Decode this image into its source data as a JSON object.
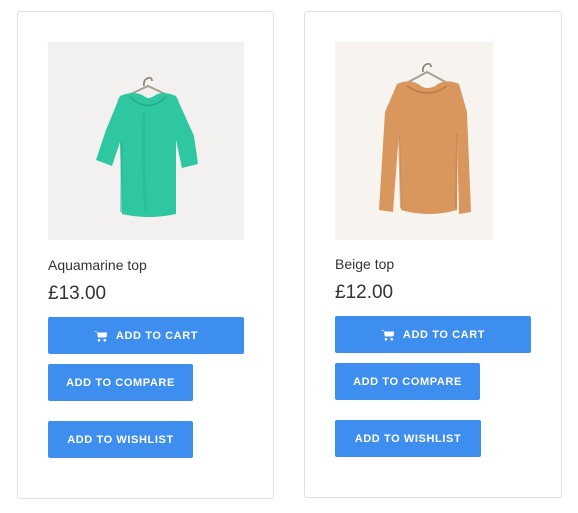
{
  "products": [
    {
      "title": "Aquamarine top",
      "price": "£13.00",
      "add_to_cart_label": "ADD TO CART",
      "add_to_compare_label": "ADD TO COMPARE",
      "add_to_wishlist_label": "ADD TO WISHLIST",
      "image_color": "#2ec7a2"
    },
    {
      "title": "Beige top",
      "price": "£12.00",
      "add_to_cart_label": "ADD TO CART",
      "add_to_compare_label": "ADD TO COMPARE",
      "add_to_wishlist_label": "ADD TO WISHLIST",
      "image_color": "#d9975e"
    }
  ],
  "colors": {
    "button": "#3d8eef",
    "text": "#333333",
    "card_border": "#e3e3e3"
  },
  "icons": {
    "cart": "shopping-cart-icon"
  }
}
